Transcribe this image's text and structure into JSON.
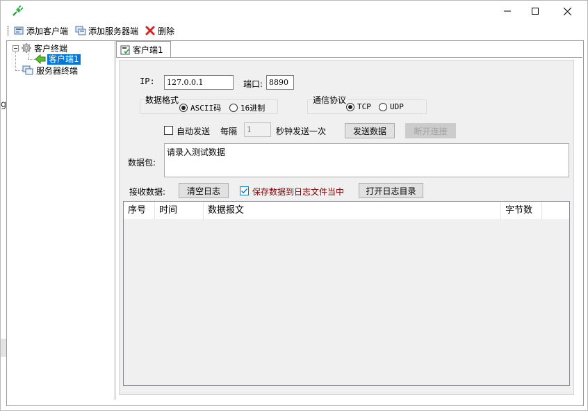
{
  "toolbar": {
    "add_client": "添加客户端",
    "add_server": "添加服务器端",
    "delete": "删除"
  },
  "tree": {
    "client_root": "客户终端",
    "client_child": "客户端1",
    "server_root": "服务器终端"
  },
  "stray_left_char": "g",
  "tab": {
    "label": "客户端1"
  },
  "form": {
    "ip_label": "IP:",
    "ip_value": "127.0.0.1",
    "port_label": "端口:",
    "port_value": "8890",
    "format_group_title": "数据格式",
    "format_ascii": "ASCII码",
    "format_hex": "16进制",
    "format_selected": "ASCII码",
    "protocol_group_title": "通信协议",
    "protocol_tcp": "TCP",
    "protocol_udp": "UDP",
    "protocol_selected": "TCP",
    "auto_send_label": "自动发送",
    "auto_send_checked": false,
    "interval_prefix": "每隔",
    "interval_value": "1",
    "interval_suffix": "秒钟发送一次",
    "send_button": "发送数据",
    "disconnect_button": "断开连接",
    "packet_label": "数据包:",
    "packet_value": "请录入测试数据"
  },
  "receive": {
    "label": "接收数据:",
    "clear_log_button": "清空日志",
    "save_to_log_label": "保存数据到日志文件当中",
    "save_to_log_checked": true,
    "open_log_dir_button": "打开日志目录"
  },
  "table": {
    "columns": [
      "序号",
      "时间",
      "数据报文",
      "字节数"
    ],
    "rows": []
  },
  "colors": {
    "selection": "#0078d7",
    "save_label_text": "#800000",
    "panel_bg": "#f0f0f0"
  },
  "icons": {
    "app": "green-plug-icon",
    "add_client": "add-client-icon",
    "add_server": "add-server-icon",
    "delete": "red-x-icon",
    "tab": "tab-page-icon",
    "client_root": "gear-icon",
    "client_child": "green-arrow-icon",
    "server_root": "server-icon"
  }
}
